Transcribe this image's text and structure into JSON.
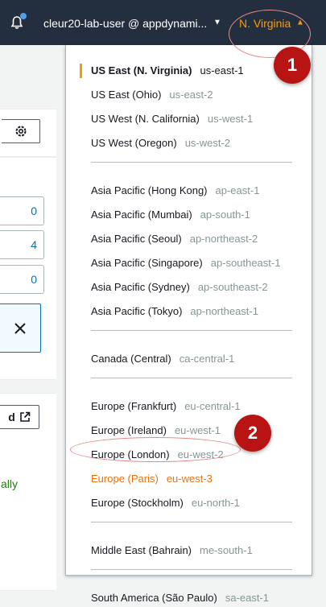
{
  "topbar": {
    "notification_icon": "bell-icon",
    "user_label": "cleur20-lab-user @ appdynami...",
    "region_label": "N. Virginia",
    "region_color": "#ff9900"
  },
  "background": {
    "counts": [
      "0",
      "4",
      "0"
    ],
    "button_d_label": "d",
    "status_text": "ally",
    "status_color": "#1d8102"
  },
  "region_menu": {
    "groups": [
      [
        {
          "name": "US East (N. Virginia)",
          "code": "us-east-1",
          "selected": true
        },
        {
          "name": "US East (Ohio)",
          "code": "us-east-2"
        },
        {
          "name": "US West (N. California)",
          "code": "us-west-1"
        },
        {
          "name": "US West (Oregon)",
          "code": "us-west-2"
        }
      ],
      [
        {
          "name": "Asia Pacific (Hong Kong)",
          "code": "ap-east-1"
        },
        {
          "name": "Asia Pacific (Mumbai)",
          "code": "ap-south-1"
        },
        {
          "name": "Asia Pacific (Seoul)",
          "code": "ap-northeast-2"
        },
        {
          "name": "Asia Pacific (Singapore)",
          "code": "ap-southeast-1"
        },
        {
          "name": "Asia Pacific (Sydney)",
          "code": "ap-southeast-2"
        },
        {
          "name": "Asia Pacific (Tokyo)",
          "code": "ap-northeast-1"
        }
      ],
      [
        {
          "name": "Canada (Central)",
          "code": "ca-central-1"
        }
      ],
      [
        {
          "name": "Europe (Frankfurt)",
          "code": "eu-central-1"
        },
        {
          "name": "Europe (Ireland)",
          "code": "eu-west-1"
        },
        {
          "name": "Europe (London)",
          "code": "eu-west-2"
        },
        {
          "name": "Europe (Paris)",
          "code": "eu-west-3",
          "highlighted": true
        },
        {
          "name": "Europe (Stockholm)",
          "code": "eu-north-1"
        }
      ],
      [
        {
          "name": "Middle East (Bahrain)",
          "code": "me-south-1"
        }
      ],
      [
        {
          "name": "South America (São Paulo)",
          "code": "sa-east-1"
        }
      ]
    ]
  },
  "annotations": {
    "badge_1": "1",
    "badge_2": "2",
    "color": "#b81414"
  }
}
